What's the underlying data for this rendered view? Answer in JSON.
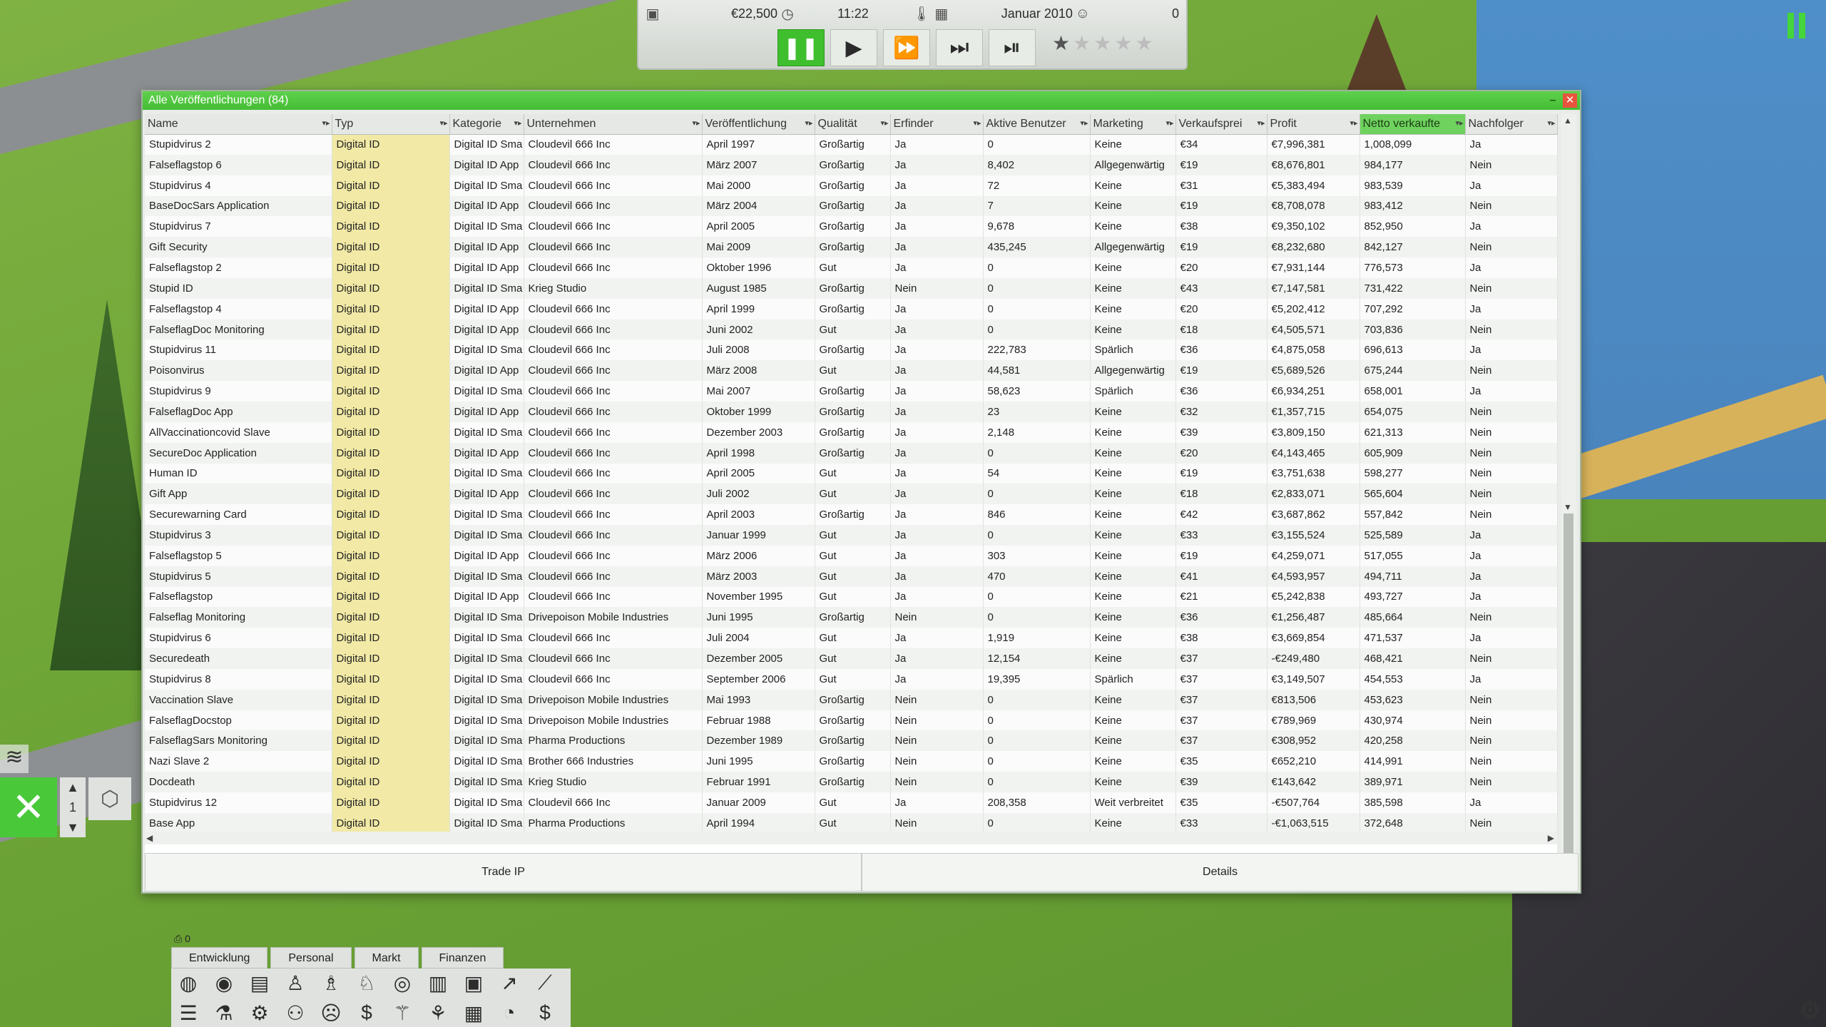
{
  "hud": {
    "money": "€22,500",
    "time": "11:22",
    "date": "Januar 2010",
    "score": "0",
    "controls": [
      "pause",
      "play",
      "fast-forward",
      "faster",
      "skip"
    ]
  },
  "window": {
    "title": "Alle Veröffentlichungen (84)"
  },
  "columns": [
    "Name",
    "Typ",
    "Kategorie",
    "Unternehmen",
    "Veröffentlichung",
    "Qualität",
    "Erfinder",
    "Aktive Benutzer",
    "Marketing",
    "Verkaufsprei",
    "Profit",
    "Netto verkaufte",
    "Nachfolger"
  ],
  "rows": [
    [
      "Stupidvirus 2",
      "Digital ID",
      "Digital ID Sma",
      "Cloudevil 666 Inc",
      "April 1997",
      "Großartig",
      "Ja",
      "0",
      "Keine",
      "€34",
      "€7,996,381",
      "1,008,099",
      "Ja"
    ],
    [
      "Falseflagstop 6",
      "Digital ID",
      "Digital ID App",
      "Cloudevil 666 Inc",
      "März 2007",
      "Großartig",
      "Ja",
      "8,402",
      "Allgegenwärtig",
      "€19",
      "€8,676,801",
      "984,177",
      "Nein"
    ],
    [
      "Stupidvirus 4",
      "Digital ID",
      "Digital ID Sma",
      "Cloudevil 666 Inc",
      "Mai 2000",
      "Großartig",
      "Ja",
      "72",
      "Keine",
      "€31",
      "€5,383,494",
      "983,539",
      "Ja"
    ],
    [
      "BaseDocSars Application",
      "Digital ID",
      "Digital ID App",
      "Cloudevil 666 Inc",
      "März 2004",
      "Großartig",
      "Ja",
      "7",
      "Keine",
      "€19",
      "€8,708,078",
      "983,412",
      "Nein"
    ],
    [
      "Stupidvirus 7",
      "Digital ID",
      "Digital ID Sma",
      "Cloudevil 666 Inc",
      "April 2005",
      "Großartig",
      "Ja",
      "9,678",
      "Keine",
      "€38",
      "€9,350,102",
      "852,950",
      "Ja"
    ],
    [
      "Gift Security",
      "Digital ID",
      "Digital ID App",
      "Cloudevil 666 Inc",
      "Mai 2009",
      "Großartig",
      "Ja",
      "435,245",
      "Allgegenwärtig",
      "€19",
      "€8,232,680",
      "842,127",
      "Nein"
    ],
    [
      "Falseflagstop 2",
      "Digital ID",
      "Digital ID App",
      "Cloudevil 666 Inc",
      "Oktober 1996",
      "Gut",
      "Ja",
      "0",
      "Keine",
      "€20",
      "€7,931,144",
      "776,573",
      "Ja"
    ],
    [
      "Stupid ID",
      "Digital ID",
      "Digital ID Sma",
      "Krieg Studio",
      "August 1985",
      "Großartig",
      "Nein",
      "0",
      "Keine",
      "€43",
      "€7,147,581",
      "731,422",
      "Nein"
    ],
    [
      "Falseflagstop 4",
      "Digital ID",
      "Digital ID App",
      "Cloudevil 666 Inc",
      "April 1999",
      "Großartig",
      "Ja",
      "0",
      "Keine",
      "€20",
      "€5,202,412",
      "707,292",
      "Ja"
    ],
    [
      "FalseflagDoc Monitoring",
      "Digital ID",
      "Digital ID App",
      "Cloudevil 666 Inc",
      "Juni 2002",
      "Gut",
      "Ja",
      "0",
      "Keine",
      "€18",
      "€4,505,571",
      "703,836",
      "Nein"
    ],
    [
      "Stupidvirus 11",
      "Digital ID",
      "Digital ID Sma",
      "Cloudevil 666 Inc",
      "Juli 2008",
      "Großartig",
      "Ja",
      "222,783",
      "Spärlich",
      "€36",
      "€4,875,058",
      "696,613",
      "Ja"
    ],
    [
      "Poisonvirus",
      "Digital ID",
      "Digital ID App",
      "Cloudevil 666 Inc",
      "März 2008",
      "Gut",
      "Ja",
      "44,581",
      "Allgegenwärtig",
      "€19",
      "€5,689,526",
      "675,244",
      "Nein"
    ],
    [
      "Stupidvirus 9",
      "Digital ID",
      "Digital ID Sma",
      "Cloudevil 666 Inc",
      "Mai 2007",
      "Großartig",
      "Ja",
      "58,623",
      "Spärlich",
      "€36",
      "€6,934,251",
      "658,001",
      "Ja"
    ],
    [
      "FalseflagDoc App",
      "Digital ID",
      "Digital ID App",
      "Cloudevil 666 Inc",
      "Oktober 1999",
      "Großartig",
      "Ja",
      "23",
      "Keine",
      "€32",
      "€1,357,715",
      "654,075",
      "Nein"
    ],
    [
      "AllVaccinationcovid Slave",
      "Digital ID",
      "Digital ID Sma",
      "Cloudevil 666 Inc",
      "Dezember 2003",
      "Großartig",
      "Ja",
      "2,148",
      "Keine",
      "€39",
      "€3,809,150",
      "621,313",
      "Nein"
    ],
    [
      "SecureDoc Application",
      "Digital ID",
      "Digital ID App",
      "Cloudevil 666 Inc",
      "April 1998",
      "Großartig",
      "Ja",
      "0",
      "Keine",
      "€20",
      "€4,143,465",
      "605,909",
      "Nein"
    ],
    [
      "Human ID",
      "Digital ID",
      "Digital ID Sma",
      "Cloudevil 666 Inc",
      "April 2005",
      "Gut",
      "Ja",
      "54",
      "Keine",
      "€19",
      "€3,751,638",
      "598,277",
      "Nein"
    ],
    [
      "Gift App",
      "Digital ID",
      "Digital ID App",
      "Cloudevil 666 Inc",
      "Juli 2002",
      "Gut",
      "Ja",
      "0",
      "Keine",
      "€18",
      "€2,833,071",
      "565,604",
      "Nein"
    ],
    [
      "Securewarning Card",
      "Digital ID",
      "Digital ID Sma",
      "Cloudevil 666 Inc",
      "April 2003",
      "Großartig",
      "Ja",
      "846",
      "Keine",
      "€42",
      "€3,687,862",
      "557,842",
      "Nein"
    ],
    [
      "Stupidvirus 3",
      "Digital ID",
      "Digital ID Sma",
      "Cloudevil 666 Inc",
      "Januar 1999",
      "Gut",
      "Ja",
      "0",
      "Keine",
      "€33",
      "€3,155,524",
      "525,589",
      "Ja"
    ],
    [
      "Falseflagstop 5",
      "Digital ID",
      "Digital ID App",
      "Cloudevil 666 Inc",
      "März 2006",
      "Gut",
      "Ja",
      "303",
      "Keine",
      "€19",
      "€4,259,071",
      "517,055",
      "Ja"
    ],
    [
      "Stupidvirus 5",
      "Digital ID",
      "Digital ID Sma",
      "Cloudevil 666 Inc",
      "März 2003",
      "Gut",
      "Ja",
      "470",
      "Keine",
      "€41",
      "€4,593,957",
      "494,711",
      "Ja"
    ],
    [
      "Falseflagstop",
      "Digital ID",
      "Digital ID App",
      "Cloudevil 666 Inc",
      "November 1995",
      "Gut",
      "Ja",
      "0",
      "Keine",
      "€21",
      "€5,242,838",
      "493,727",
      "Ja"
    ],
    [
      "Falseflag Monitoring",
      "Digital ID",
      "Digital ID Sma",
      "Drivepoison Mobile Industries",
      "Juni 1995",
      "Großartig",
      "Nein",
      "0",
      "Keine",
      "€36",
      "€1,256,487",
      "485,664",
      "Nein"
    ],
    [
      "Stupidvirus 6",
      "Digital ID",
      "Digital ID Sma",
      "Cloudevil 666 Inc",
      "Juli 2004",
      "Gut",
      "Ja",
      "1,919",
      "Keine",
      "€38",
      "€3,669,854",
      "471,537",
      "Ja"
    ],
    [
      "Securedeath",
      "Digital ID",
      "Digital ID Sma",
      "Cloudevil 666 Inc",
      "Dezember 2005",
      "Gut",
      "Ja",
      "12,154",
      "Keine",
      "€37",
      "-€249,480",
      "468,421",
      "Nein"
    ],
    [
      "Stupidvirus 8",
      "Digital ID",
      "Digital ID Sma",
      "Cloudevil 666 Inc",
      "September 2006",
      "Gut",
      "Ja",
      "19,395",
      "Spärlich",
      "€37",
      "€3,149,507",
      "454,553",
      "Ja"
    ],
    [
      "Vaccination Slave",
      "Digital ID",
      "Digital ID Sma",
      "Drivepoison Mobile Industries",
      "Mai 1993",
      "Großartig",
      "Nein",
      "0",
      "Keine",
      "€37",
      "€813,506",
      "453,623",
      "Nein"
    ],
    [
      "FalseflagDocstop",
      "Digital ID",
      "Digital ID Sma",
      "Drivepoison Mobile Industries",
      "Februar 1988",
      "Großartig",
      "Nein",
      "0",
      "Keine",
      "€37",
      "€789,969",
      "430,974",
      "Nein"
    ],
    [
      "FalseflagSars Monitoring",
      "Digital ID",
      "Digital ID Sma",
      "Pharma Productions",
      "Dezember 1989",
      "Großartig",
      "Nein",
      "0",
      "Keine",
      "€37",
      "€308,952",
      "420,258",
      "Nein"
    ],
    [
      "Nazi Slave 2",
      "Digital ID",
      "Digital ID Sma",
      "Brother 666 Industries",
      "Juni 1995",
      "Großartig",
      "Nein",
      "0",
      "Keine",
      "€35",
      "€652,210",
      "414,991",
      "Nein"
    ],
    [
      "Docdeath",
      "Digital ID",
      "Digital ID Sma",
      "Krieg Studio",
      "Februar 1991",
      "Großartig",
      "Nein",
      "0",
      "Keine",
      "€39",
      "€143,642",
      "389,971",
      "Nein"
    ],
    [
      "Stupidvirus 12",
      "Digital ID",
      "Digital ID Sma",
      "Cloudevil 666 Inc",
      "Januar 2009",
      "Gut",
      "Ja",
      "208,358",
      "Weit verbreitet",
      "€35",
      "-€507,764",
      "385,598",
      "Ja"
    ],
    [
      "Base App",
      "Digital ID",
      "Digital ID Sma",
      "Pharma Productions",
      "April 1994",
      "Gut",
      "Nein",
      "0",
      "Keine",
      "€33",
      "-€1,063,515",
      "372,648",
      "Nein"
    ]
  ],
  "footer": {
    "trade_ip": "Trade IP",
    "details": "Details"
  },
  "side": {
    "level_number": "1"
  },
  "bottom_bar": {
    "stat_value": "0",
    "tabs": [
      "Entwicklung",
      "Personal",
      "Markt",
      "Finanzen"
    ]
  }
}
